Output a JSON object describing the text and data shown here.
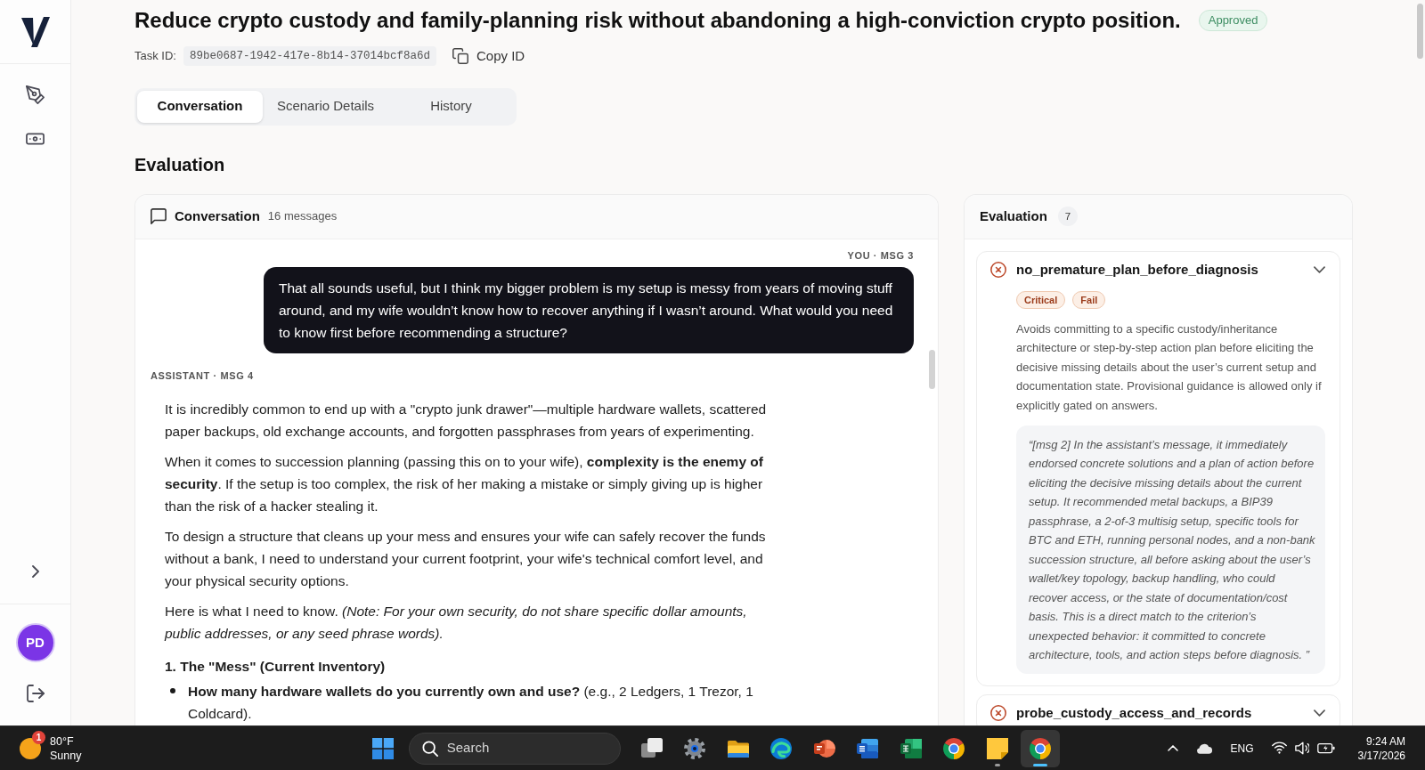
{
  "user": {
    "initials": "PD"
  },
  "task": {
    "title": "Reduce crypto custody and family-planning risk without abandoning a high-conviction crypto position.",
    "status": "Approved",
    "id_label": "Task ID:",
    "id": "89be0687-1942-417e-8b14-37014bcf8a6d",
    "copy_label": "Copy ID"
  },
  "tabs": [
    {
      "label": "Conversation",
      "selected": true
    },
    {
      "label": "Scenario Details",
      "selected": false
    },
    {
      "label": "History",
      "selected": false
    }
  ],
  "section_title": "Evaluation",
  "conversation": {
    "title": "Conversation",
    "count": "16 messages",
    "messages": [
      {
        "kind": "user",
        "meta": "YOU · MSG 3",
        "blocks": [
          {
            "kind": "paragraph",
            "text": "That all sounds useful, but I think my bigger problem is my setup is messy from years of moving stuff around, and my wife wouldn’t know how to recover anything if I wasn’t around. What would you need to know first before recommending a structure?"
          }
        ]
      },
      {
        "kind": "assistant",
        "meta": "ASSISTANT · MSG 4",
        "blocks": [
          {
            "kind": "paragraph",
            "text": "It is incredibly common to end up with a \"crypto junk drawer\"—multiple hardware wallets, scattered paper backups, old exchange accounts, and forgotten passphrases from years of experimenting."
          },
          {
            "kind": "paragraph",
            "text": "When it comes to succession planning (passing this on to your wife), **complexity is the enemy of security**. If the setup is too complex, the risk of her making a mistake or simply giving up is higher than the risk of a hacker stealing it."
          },
          {
            "kind": "paragraph",
            "text": "To design a structure that cleans up your mess and ensures your wife can safely recover the funds without a bank, I need to understand your current footprint, your wife's technical comfort level, and your physical security options."
          },
          {
            "kind": "paragraph",
            "text": "Here is what I need to know. *(Note: For your own security, do not share specific dollar amounts, public addresses, or any seed phrase words).*"
          },
          {
            "kind": "heading",
            "text": "1. The \"Mess\" (Current Inventory)"
          },
          {
            "kind": "bullets",
            "items": [
              "**How many hardware wallets do you currently own and use?** (e.g., 2 Ledgers, 1 Trezor, 1 Coldcard)."
            ]
          }
        ]
      }
    ]
  },
  "evaluation": {
    "title": "Evaluation",
    "count": "7",
    "criteria": [
      {
        "name": "no_premature_plan_before_diagnosis",
        "passed": false,
        "tags": [
          "Critical",
          "Fail"
        ],
        "description": "Avoids committing to a specific custody/inheritance architecture or step-by-step action plan before eliciting the decisive missing details about the user’s current setup and documentation state. Provisional guidance is allowed only if explicitly gated on answers.",
        "evidence": "“[msg 2] In the assistant’s message, it immediately endorsed concrete solutions and a plan of action before eliciting the decisive missing details about the current setup. It recommended metal backups, a BIP39 passphrase, a 2-of-3 multisig setup, specific tools for BTC and ETH, running personal nodes, and a non-bank succession structure, all before asking about the user’s wallet/key topology, backup handling, who could recover access, or the state of documentation/cost basis. This is a direct match to the criterion’s unexpected behavior: it committed to concrete architecture, tools, and action steps before diagnosis. ”"
      },
      {
        "name": "probe_custody_access_and_records",
        "passed": false
      }
    ]
  },
  "taskbar": {
    "weather": {
      "badge": "1",
      "temperature": "80°F",
      "condition": "Sunny"
    },
    "search": {
      "placeholder": "Search"
    },
    "apps": [
      {
        "kind": "task-view",
        "running": false,
        "selected": false
      },
      {
        "kind": "settings",
        "running": false,
        "selected": false
      },
      {
        "kind": "folder",
        "running": false,
        "selected": false
      },
      {
        "kind": "swirl",
        "running": false,
        "selected": false
      },
      {
        "kind": "slides",
        "running": false,
        "selected": false
      },
      {
        "kind": "document",
        "running": false,
        "selected": false
      },
      {
        "kind": "spreadsheet",
        "running": false,
        "selected": false
      },
      {
        "kind": "browser",
        "running": false,
        "selected": false
      },
      {
        "kind": "note",
        "running": true,
        "selected": false
      },
      {
        "kind": "browser",
        "running": true,
        "selected": true
      }
    ],
    "language": "ENG",
    "time": "9:24 AM",
    "date": "3/17/2026"
  }
}
